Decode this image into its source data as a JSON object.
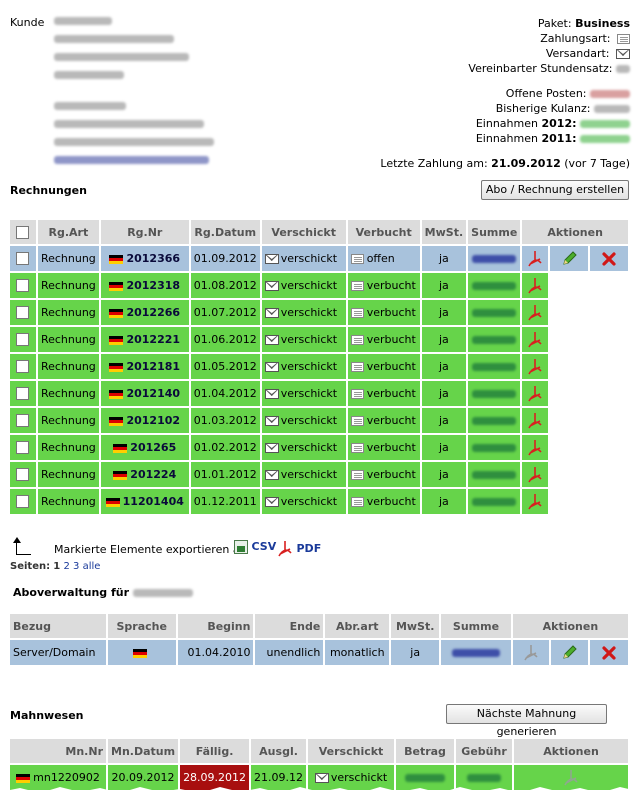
{
  "customer": {
    "label": "Kunde"
  },
  "meta": {
    "paket_label": "Paket:",
    "paket_value": "Business",
    "zahlungsart_label": "Zahlungsart:",
    "versandart_label": "Versandart:",
    "stundensatz_label": "Vereinbarter Stundensatz:",
    "offene_label": "Offene Posten:",
    "kulanz_label": "Bisherige Kulanz:",
    "einnahmen2012_label": "Einnahmen",
    "einnahmen2012_year": "2012:",
    "einnahmen2011_label": "Einnahmen",
    "einnahmen2011_year": "2011:",
    "letzte_label": "Letzte Zahlung am:",
    "letzte_date": "21.09.2012",
    "letzte_suffix": "(vor 7 Tage)"
  },
  "rechnungen": {
    "title": "Rechnungen",
    "create_button": "Abo / Rechnung erstellen",
    "headers": [
      "Rg.Art",
      "Rg.Nr",
      "Rg.Datum",
      "Verschickt",
      "Verbucht",
      "MwSt.",
      "Summe",
      "Aktionen"
    ],
    "rows": [
      {
        "art": "Rechnung",
        "nr": "2012366",
        "datum": "01.09.2012",
        "verschickt": "verschickt",
        "verbucht": "offen",
        "mwst": "ja",
        "status": "blue"
      },
      {
        "art": "Rechnung",
        "nr": "2012318",
        "datum": "01.08.2012",
        "verschickt": "verschickt",
        "verbucht": "verbucht",
        "mwst": "ja",
        "status": "green"
      },
      {
        "art": "Rechnung",
        "nr": "2012266",
        "datum": "01.07.2012",
        "verschickt": "verschickt",
        "verbucht": "verbucht",
        "mwst": "ja",
        "status": "green"
      },
      {
        "art": "Rechnung",
        "nr": "2012221",
        "datum": "01.06.2012",
        "verschickt": "verschickt",
        "verbucht": "verbucht",
        "mwst": "ja",
        "status": "green"
      },
      {
        "art": "Rechnung",
        "nr": "2012181",
        "datum": "01.05.2012",
        "verschickt": "verschickt",
        "verbucht": "verbucht",
        "mwst": "ja",
        "status": "green"
      },
      {
        "art": "Rechnung",
        "nr": "2012140",
        "datum": "01.04.2012",
        "verschickt": "verschickt",
        "verbucht": "verbucht",
        "mwst": "ja",
        "status": "green"
      },
      {
        "art": "Rechnung",
        "nr": "2012102",
        "datum": "01.03.2012",
        "verschickt": "verschickt",
        "verbucht": "verbucht",
        "mwst": "ja",
        "status": "green"
      },
      {
        "art": "Rechnung",
        "nr": "201265",
        "datum": "01.02.2012",
        "verschickt": "verschickt",
        "verbucht": "verbucht",
        "mwst": "ja",
        "status": "green"
      },
      {
        "art": "Rechnung",
        "nr": "201224",
        "datum": "01.01.2012",
        "verschickt": "verschickt",
        "verbucht": "verbucht",
        "mwst": "ja",
        "status": "green"
      },
      {
        "art": "Rechnung",
        "nr": "11201404",
        "datum": "01.12.2011",
        "verschickt": "verschickt",
        "verbucht": "verbucht",
        "mwst": "ja",
        "status": "green"
      }
    ],
    "export_label": "Markierte Elemente exportieren als",
    "csv": "CSV",
    "pdf": "PDF",
    "pages_label": "Seiten:",
    "pages": [
      "1",
      "2",
      "3",
      "alle"
    ]
  },
  "abo": {
    "title": "Aboverwaltung für",
    "headers": [
      "Bezug",
      "Sprache",
      "Beginn",
      "Ende",
      "Abr.art",
      "MwSt.",
      "Summe",
      "Aktionen"
    ],
    "row": {
      "bezug": "Server/Domain",
      "beginn": "01.04.2010",
      "ende": "unendlich",
      "abrart": "monatlich",
      "mwst": "ja"
    }
  },
  "mahn": {
    "title": "Mahnwesen",
    "button": "Nächste Mahnung generieren",
    "headers": [
      "Mn.Nr",
      "Mn.Datum",
      "Fällig.",
      "Ausgl.",
      "Verschickt",
      "Betrag",
      "Gebühr",
      "Aktionen"
    ],
    "row": {
      "nr": "mn1220902",
      "datum": "20.09.2012",
      "faellig": "28.09.2012",
      "ausgl": "21.09.12",
      "verschickt": "verschickt"
    }
  },
  "colors": {
    "green": "#66d44a",
    "blue": "#a8c2dc",
    "header": "#dcdcdc",
    "overdue": "#a80f0f"
  },
  "icons": [
    "checkbox-icon",
    "german-flag-icon",
    "envelope-icon",
    "document-icon",
    "pdf-icon",
    "pencil-icon",
    "delete-icon",
    "csv-icon",
    "export-arrow-icon"
  ]
}
